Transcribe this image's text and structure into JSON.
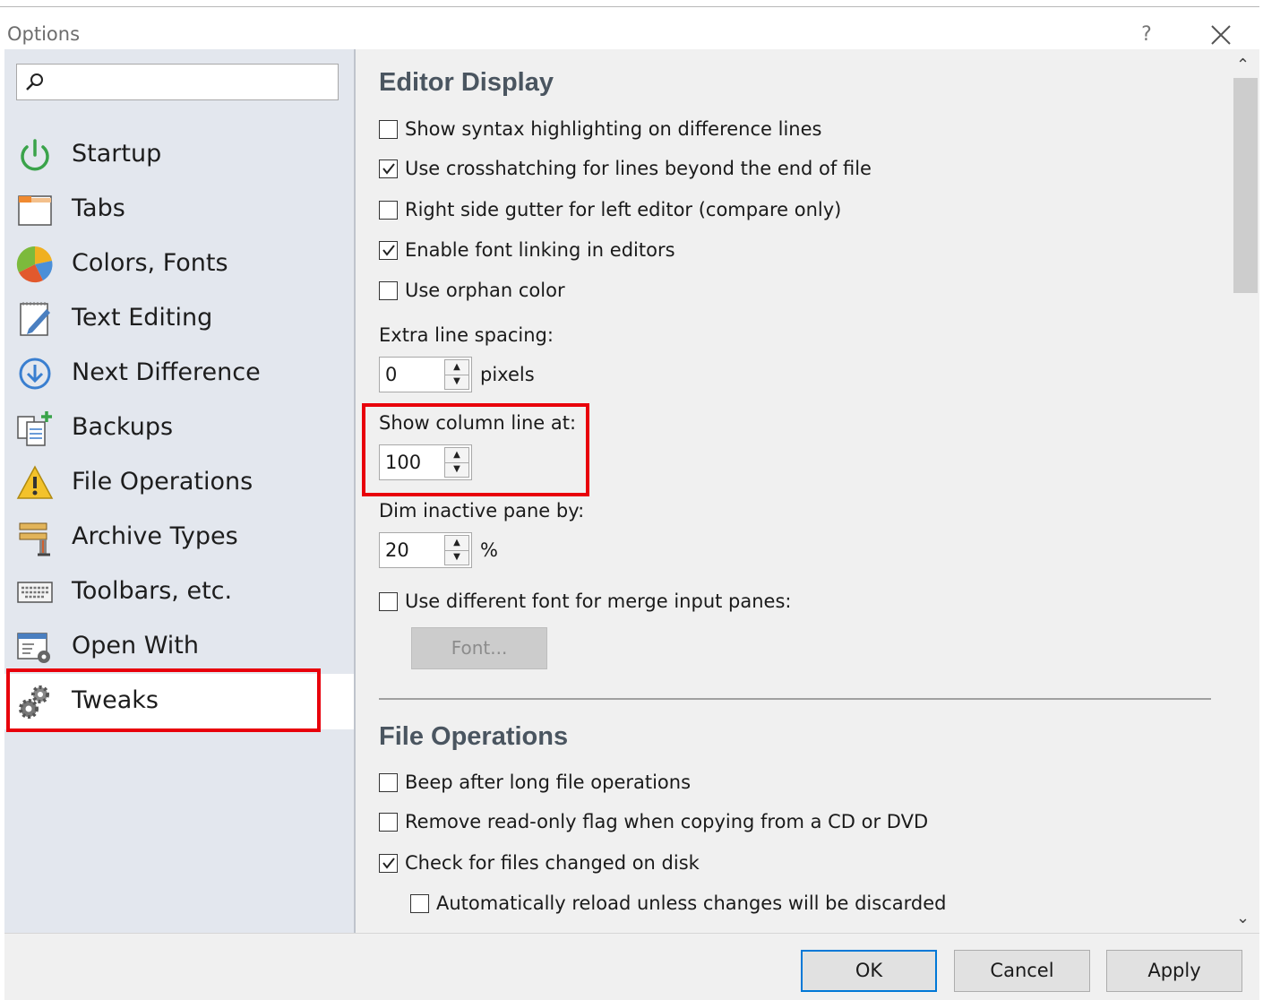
{
  "window": {
    "title": "Options",
    "help_label": "?"
  },
  "search": {
    "placeholder": ""
  },
  "sidebar": {
    "items": [
      {
        "label": "Startup",
        "icon": "power-icon"
      },
      {
        "label": "Tabs",
        "icon": "tabs-icon"
      },
      {
        "label": "Colors, Fonts",
        "icon": "color-wheel-icon"
      },
      {
        "label": "Text Editing",
        "icon": "notepad-pencil-icon"
      },
      {
        "label": "Next Difference",
        "icon": "down-arrow-circle-icon"
      },
      {
        "label": "Backups",
        "icon": "copy-plus-icon"
      },
      {
        "label": "File Operations",
        "icon": "warning-icon"
      },
      {
        "label": "Archive Types",
        "icon": "vise-icon"
      },
      {
        "label": "Toolbars, etc.",
        "icon": "keyboard-icon"
      },
      {
        "label": "Open With",
        "icon": "window-gear-icon"
      },
      {
        "label": "Tweaks",
        "icon": "gears-icon",
        "selected": true
      }
    ]
  },
  "editor_display": {
    "title": "Editor Display",
    "checkboxes": [
      {
        "label": "Show syntax highlighting on difference lines",
        "checked": false
      },
      {
        "label": "Use crosshatching for lines beyond the end of file",
        "checked": true
      },
      {
        "label": "Right side gutter for left editor (compare only)",
        "checked": false
      },
      {
        "label": "Enable font linking in editors",
        "checked": true
      },
      {
        "label": "Use orphan color",
        "checked": false
      }
    ],
    "extra_line_spacing": {
      "label": "Extra line spacing:",
      "value": "0",
      "unit": "pixels"
    },
    "column_line": {
      "label": "Show column line at:",
      "value": "100"
    },
    "dim_inactive": {
      "label": "Dim inactive pane by:",
      "value": "20",
      "unit": "%"
    },
    "merge_font": {
      "label": "Use different font for merge input panes:",
      "checked": false
    },
    "font_button": "Font..."
  },
  "file_operations": {
    "title": "File Operations",
    "checkboxes": [
      {
        "label": "Beep after long file operations",
        "checked": false
      },
      {
        "label": "Remove read-only flag when copying from a CD or DVD",
        "checked": false
      },
      {
        "label": "Check for files changed on disk",
        "checked": true
      },
      {
        "label": "Automatically reload unless changes will be discarded",
        "checked": false
      }
    ]
  },
  "footer": {
    "ok": "OK",
    "cancel": "Cancel",
    "apply": "Apply"
  },
  "colors": {
    "highlight": "#e8000b",
    "sidebar_bg": "#e3e7ee",
    "content_bg": "#f0f0f0",
    "default_button_border": "#0078d7"
  }
}
